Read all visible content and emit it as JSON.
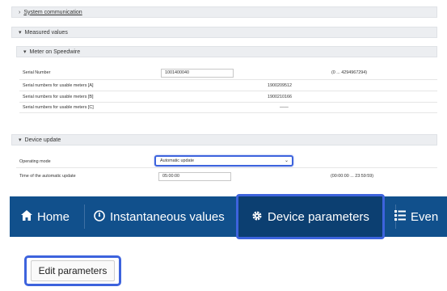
{
  "sections": {
    "system_communication": "System communication",
    "measured_values": "Measured values",
    "meter_on_speedwire": "Meter on Speedwire",
    "device_update": "Device update"
  },
  "meter_rows": [
    {
      "label": "Serial Number",
      "input_value": "1001400040",
      "range": "(0 ... 4294967294)"
    },
    {
      "label": "Serial numbers for usable meters [A]",
      "value": "1900209512"
    },
    {
      "label": "Serial numbers for usable meters [B]",
      "value": "1900210166"
    },
    {
      "label": "Serial numbers for usable meters [C]",
      "value": "——"
    }
  ],
  "device_update": {
    "operating_mode_label": "Operating mode",
    "operating_mode_value": "Automatic update",
    "time_label": "Time of the automatic update",
    "time_value": "05:00:00",
    "time_range": "(00:00:00 ... 23:59:59)"
  },
  "nav": {
    "home": "Home",
    "instantaneous": "Instantaneous values",
    "device_parameters": "Device parameters",
    "events": "Even"
  },
  "edit_button": "Edit parameters",
  "colors": {
    "nav_bg": "#11508c",
    "highlight": "#3d63dd"
  }
}
